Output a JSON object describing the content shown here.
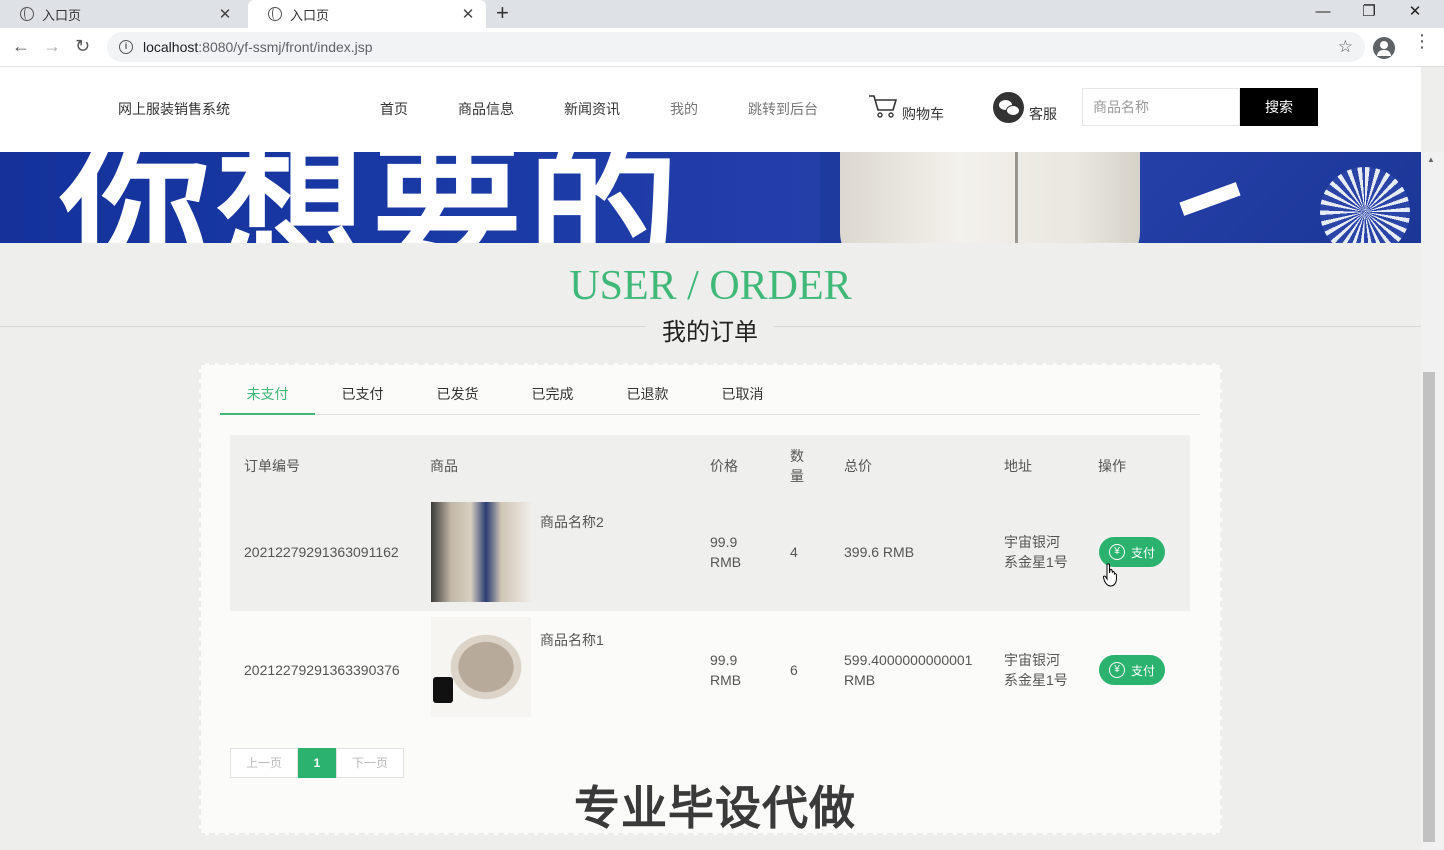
{
  "browser": {
    "tabs": [
      {
        "title": "入口页",
        "close": "✕"
      },
      {
        "title": "入口页",
        "close": "✕"
      }
    ],
    "new_tab": "+",
    "url_host": "localhost",
    "url_rest": ":8080/yf-ssmj/front/index.jsp",
    "window_controls": {
      "minimize": "—",
      "restore": "❐",
      "close": "✕"
    }
  },
  "header": {
    "brand": "网上服装销售系统",
    "nav": [
      "首页",
      "商品信息",
      "新闻资讯",
      "我的",
      "跳转到后台"
    ],
    "cart_label": "购物车",
    "service_label": "客服",
    "search_placeholder": "商品名称",
    "search_button": "搜索"
  },
  "section": {
    "title_en": "USER / ORDER",
    "title_cn": "我的订单"
  },
  "order_tabs": [
    "未支付",
    "已支付",
    "已发货",
    "已完成",
    "已退款",
    "已取消"
  ],
  "active_tab": "未支付",
  "table": {
    "headers": [
      "订单编号",
      "商品",
      "价格",
      "数量",
      "总价",
      "地址",
      "操作"
    ],
    "qty_header_lines": [
      "数",
      "量"
    ],
    "rows": [
      {
        "order_no": "20212279291363091162",
        "product": "商品名称2",
        "price_line1": "99.9",
        "price_line2": "RMB",
        "qty": "4",
        "total_line1": "399.6 RMB",
        "total_line2": "",
        "addr_line1": "宇宙银河",
        "addr_line2": "系金星1号",
        "action": "支付"
      },
      {
        "order_no": "20212279291363390376",
        "product": "商品名称1",
        "price_line1": "99.9",
        "price_line2": "RMB",
        "qty": "6",
        "total_line1": "599.4000000000001",
        "total_line2": "RMB",
        "addr_line1": "宇宙银河",
        "addr_line2": "系金星1号",
        "action": "支付"
      }
    ]
  },
  "pager": {
    "prev": "上一页",
    "current": "1",
    "next": "下一页"
  },
  "watermark": "专业毕设代做",
  "colors": {
    "accent": "#3fb878",
    "pay_button": "#2bb26e",
    "search_button": "#000000"
  },
  "icons": [
    "globe-icon",
    "cart-icon",
    "wechat-icon",
    "yen-icon",
    "star-icon",
    "profile-icon"
  ]
}
